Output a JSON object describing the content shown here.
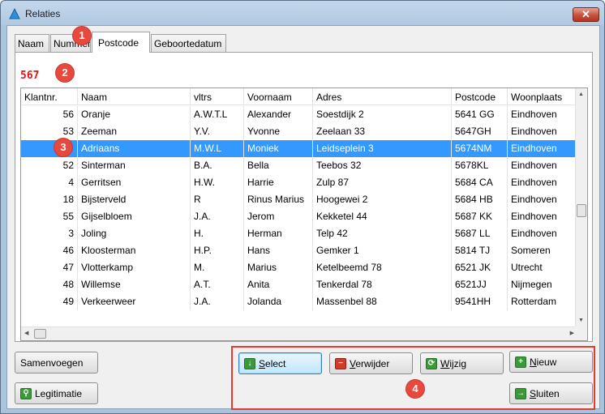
{
  "window": {
    "title": "Relaties",
    "close_glyph": "✕"
  },
  "tabs": [
    {
      "label": "Naam"
    },
    {
      "label": "Nummer"
    },
    {
      "label": "Postcode"
    },
    {
      "label": "Geboortedatum"
    }
  ],
  "count_label": "567",
  "columns": [
    "Klantnr.",
    "Naam",
    "vltrs",
    "Voornaam",
    "Adres",
    "Postcode",
    "Woonplaats"
  ],
  "rows": [
    [
      "56",
      "Oranje",
      "A.W.T.L",
      "Alexander",
      "Soestdijk 2",
      "5641 GG",
      "Eindhoven"
    ],
    [
      "53",
      "Zeeman",
      "Y.V.",
      "Yvonne",
      "Zeelaan 33",
      "5647GH",
      "Eindhoven"
    ],
    [
      "",
      "Adriaans",
      "M.W.L",
      "Moniek",
      "Leidseplein 3",
      "5674NM",
      "Eindhoven"
    ],
    [
      "52",
      "Sinterman",
      "B.A.",
      "Bella",
      "Teebos 32",
      "5678KL",
      "Eindhoven"
    ],
    [
      "4",
      "Gerritsen",
      "H.W.",
      "Harrie",
      "Zulp 87",
      "5684 CA",
      "Eindhoven"
    ],
    [
      "18",
      "Bijsterveld",
      "R",
      "Rinus Marius",
      "Hoogewei 2",
      "5684 HB",
      "Eindhoven"
    ],
    [
      "55",
      "Gijselbloem",
      "J.A.",
      "Jerom",
      "Kekketel 44",
      "5687 KK",
      "Eindhoven"
    ],
    [
      "3",
      "Joling",
      "H.",
      "Herman",
      "Telp 42",
      "5687 LL",
      "Eindhoven"
    ],
    [
      "46",
      "Kloosterman",
      "H.P.",
      "Hans",
      "Gemker 1",
      "5814 TJ",
      "Someren"
    ],
    [
      "47",
      "Vlotterkamp",
      "M.",
      "Marius",
      "Ketelbeemd 78",
      "6521 JK",
      "Utrecht"
    ],
    [
      "48",
      "Willemse",
      "A.T.",
      "Anita",
      "Tenkerdal 78",
      "6521JJ",
      "Nijmegen"
    ],
    [
      "49",
      "Verkeerweer",
      "J.A.",
      "Jolanda",
      "Massenbel 88",
      "9541HH",
      "Rotterdam"
    ]
  ],
  "buttons": {
    "samenvoegen": "Samenvoegen",
    "legitimatie": "Legitimatie",
    "select_pre": "",
    "select_u": "S",
    "select_post": "elect",
    "verwijder_pre": "",
    "verwijder_u": "V",
    "verwijder_post": "erwijder",
    "wijzig_pre": "",
    "wijzig_u": "W",
    "wijzig_post": "ijzig",
    "nieuw_pre": "",
    "nieuw_u": "N",
    "nieuw_post": "ieuw",
    "sluiten_pre": "",
    "sluiten_u": "S",
    "sluiten_post": "luiten"
  },
  "callouts": [
    "1",
    "2",
    "3",
    "4"
  ],
  "colors": {
    "selection": "#3399ff",
    "callout": "#e8493f",
    "count": "#e01515"
  }
}
